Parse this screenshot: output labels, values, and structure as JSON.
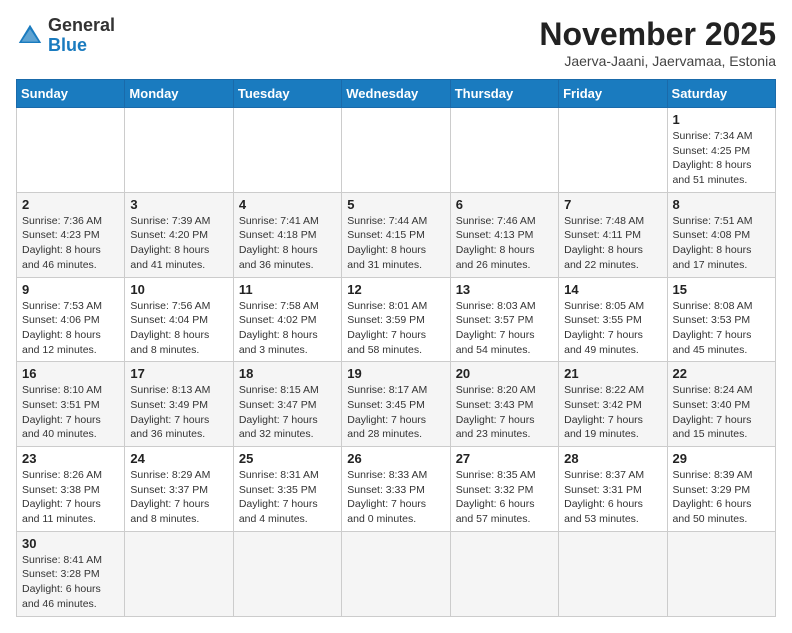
{
  "header": {
    "logo_general": "General",
    "logo_blue": "Blue",
    "month_year": "November 2025",
    "location": "Jaerva-Jaani, Jaervamaa, Estonia"
  },
  "days_of_week": [
    "Sunday",
    "Monday",
    "Tuesday",
    "Wednesday",
    "Thursday",
    "Friday",
    "Saturday"
  ],
  "weeks": [
    [
      {
        "day": "",
        "info": ""
      },
      {
        "day": "",
        "info": ""
      },
      {
        "day": "",
        "info": ""
      },
      {
        "day": "",
        "info": ""
      },
      {
        "day": "",
        "info": ""
      },
      {
        "day": "",
        "info": ""
      },
      {
        "day": "1",
        "info": "Sunrise: 7:34 AM\nSunset: 4:25 PM\nDaylight: 8 hours and 51 minutes."
      }
    ],
    [
      {
        "day": "2",
        "info": "Sunrise: 7:36 AM\nSunset: 4:23 PM\nDaylight: 8 hours and 46 minutes."
      },
      {
        "day": "3",
        "info": "Sunrise: 7:39 AM\nSunset: 4:20 PM\nDaylight: 8 hours and 41 minutes."
      },
      {
        "day": "4",
        "info": "Sunrise: 7:41 AM\nSunset: 4:18 PM\nDaylight: 8 hours and 36 minutes."
      },
      {
        "day": "5",
        "info": "Sunrise: 7:44 AM\nSunset: 4:15 PM\nDaylight: 8 hours and 31 minutes."
      },
      {
        "day": "6",
        "info": "Sunrise: 7:46 AM\nSunset: 4:13 PM\nDaylight: 8 hours and 26 minutes."
      },
      {
        "day": "7",
        "info": "Sunrise: 7:48 AM\nSunset: 4:11 PM\nDaylight: 8 hours and 22 minutes."
      },
      {
        "day": "8",
        "info": "Sunrise: 7:51 AM\nSunset: 4:08 PM\nDaylight: 8 hours and 17 minutes."
      }
    ],
    [
      {
        "day": "9",
        "info": "Sunrise: 7:53 AM\nSunset: 4:06 PM\nDaylight: 8 hours and 12 minutes."
      },
      {
        "day": "10",
        "info": "Sunrise: 7:56 AM\nSunset: 4:04 PM\nDaylight: 8 hours and 8 minutes."
      },
      {
        "day": "11",
        "info": "Sunrise: 7:58 AM\nSunset: 4:02 PM\nDaylight: 8 hours and 3 minutes."
      },
      {
        "day": "12",
        "info": "Sunrise: 8:01 AM\nSunset: 3:59 PM\nDaylight: 7 hours and 58 minutes."
      },
      {
        "day": "13",
        "info": "Sunrise: 8:03 AM\nSunset: 3:57 PM\nDaylight: 7 hours and 54 minutes."
      },
      {
        "day": "14",
        "info": "Sunrise: 8:05 AM\nSunset: 3:55 PM\nDaylight: 7 hours and 49 minutes."
      },
      {
        "day": "15",
        "info": "Sunrise: 8:08 AM\nSunset: 3:53 PM\nDaylight: 7 hours and 45 minutes."
      }
    ],
    [
      {
        "day": "16",
        "info": "Sunrise: 8:10 AM\nSunset: 3:51 PM\nDaylight: 7 hours and 40 minutes."
      },
      {
        "day": "17",
        "info": "Sunrise: 8:13 AM\nSunset: 3:49 PM\nDaylight: 7 hours and 36 minutes."
      },
      {
        "day": "18",
        "info": "Sunrise: 8:15 AM\nSunset: 3:47 PM\nDaylight: 7 hours and 32 minutes."
      },
      {
        "day": "19",
        "info": "Sunrise: 8:17 AM\nSunset: 3:45 PM\nDaylight: 7 hours and 28 minutes."
      },
      {
        "day": "20",
        "info": "Sunrise: 8:20 AM\nSunset: 3:43 PM\nDaylight: 7 hours and 23 minutes."
      },
      {
        "day": "21",
        "info": "Sunrise: 8:22 AM\nSunset: 3:42 PM\nDaylight: 7 hours and 19 minutes."
      },
      {
        "day": "22",
        "info": "Sunrise: 8:24 AM\nSunset: 3:40 PM\nDaylight: 7 hours and 15 minutes."
      }
    ],
    [
      {
        "day": "23",
        "info": "Sunrise: 8:26 AM\nSunset: 3:38 PM\nDaylight: 7 hours and 11 minutes."
      },
      {
        "day": "24",
        "info": "Sunrise: 8:29 AM\nSunset: 3:37 PM\nDaylight: 7 hours and 8 minutes."
      },
      {
        "day": "25",
        "info": "Sunrise: 8:31 AM\nSunset: 3:35 PM\nDaylight: 7 hours and 4 minutes."
      },
      {
        "day": "26",
        "info": "Sunrise: 8:33 AM\nSunset: 3:33 PM\nDaylight: 7 hours and 0 minutes."
      },
      {
        "day": "27",
        "info": "Sunrise: 8:35 AM\nSunset: 3:32 PM\nDaylight: 6 hours and 57 minutes."
      },
      {
        "day": "28",
        "info": "Sunrise: 8:37 AM\nSunset: 3:31 PM\nDaylight: 6 hours and 53 minutes."
      },
      {
        "day": "29",
        "info": "Sunrise: 8:39 AM\nSunset: 3:29 PM\nDaylight: 6 hours and 50 minutes."
      }
    ],
    [
      {
        "day": "30",
        "info": "Sunrise: 8:41 AM\nSunset: 3:28 PM\nDaylight: 6 hours and 46 minutes."
      },
      {
        "day": "",
        "info": ""
      },
      {
        "day": "",
        "info": ""
      },
      {
        "day": "",
        "info": ""
      },
      {
        "day": "",
        "info": ""
      },
      {
        "day": "",
        "info": ""
      },
      {
        "day": "",
        "info": ""
      }
    ]
  ]
}
